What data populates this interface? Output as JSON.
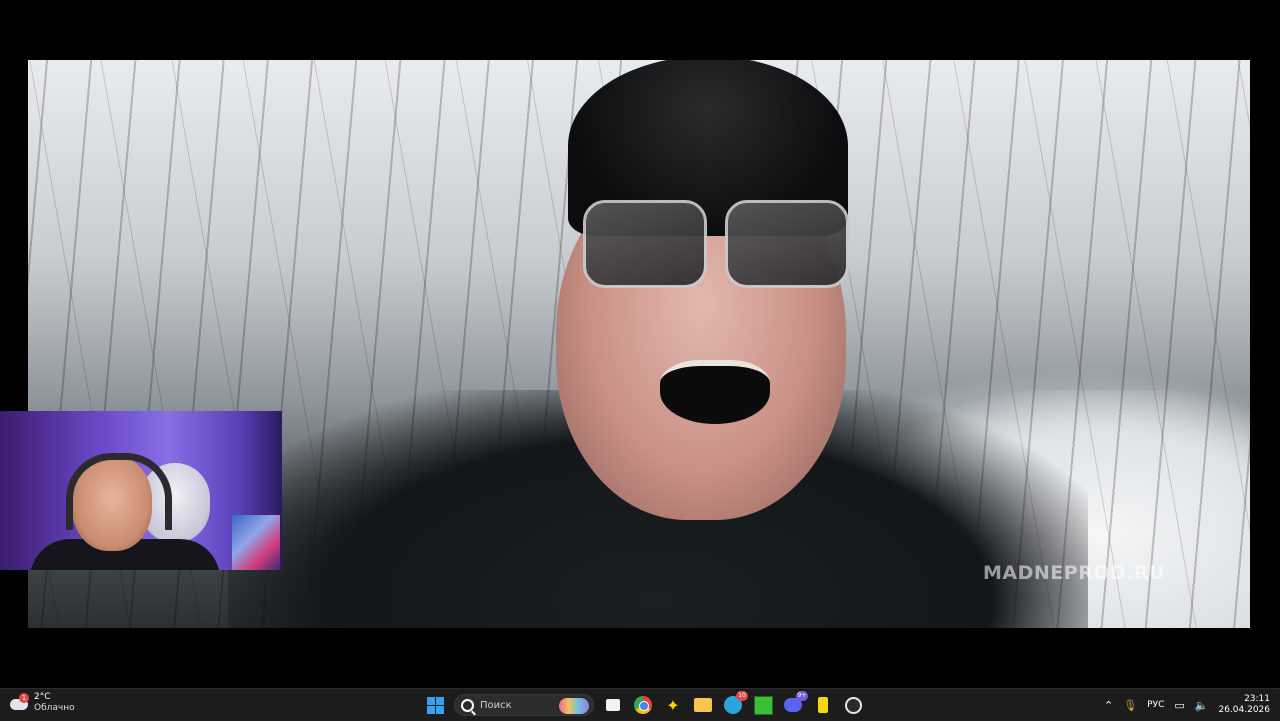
{
  "video": {
    "watermark": "MADNEPROD.RU"
  },
  "taskbar": {
    "weather": {
      "badge": "1",
      "temperature": "2°C",
      "condition": "Облачно"
    },
    "search": {
      "placeholder": "Поиск"
    },
    "badges": {
      "telegram": "10",
      "discord": "9+"
    },
    "tray": {
      "language": "РУС",
      "time": "23:11",
      "date": "26.04.2026"
    }
  }
}
